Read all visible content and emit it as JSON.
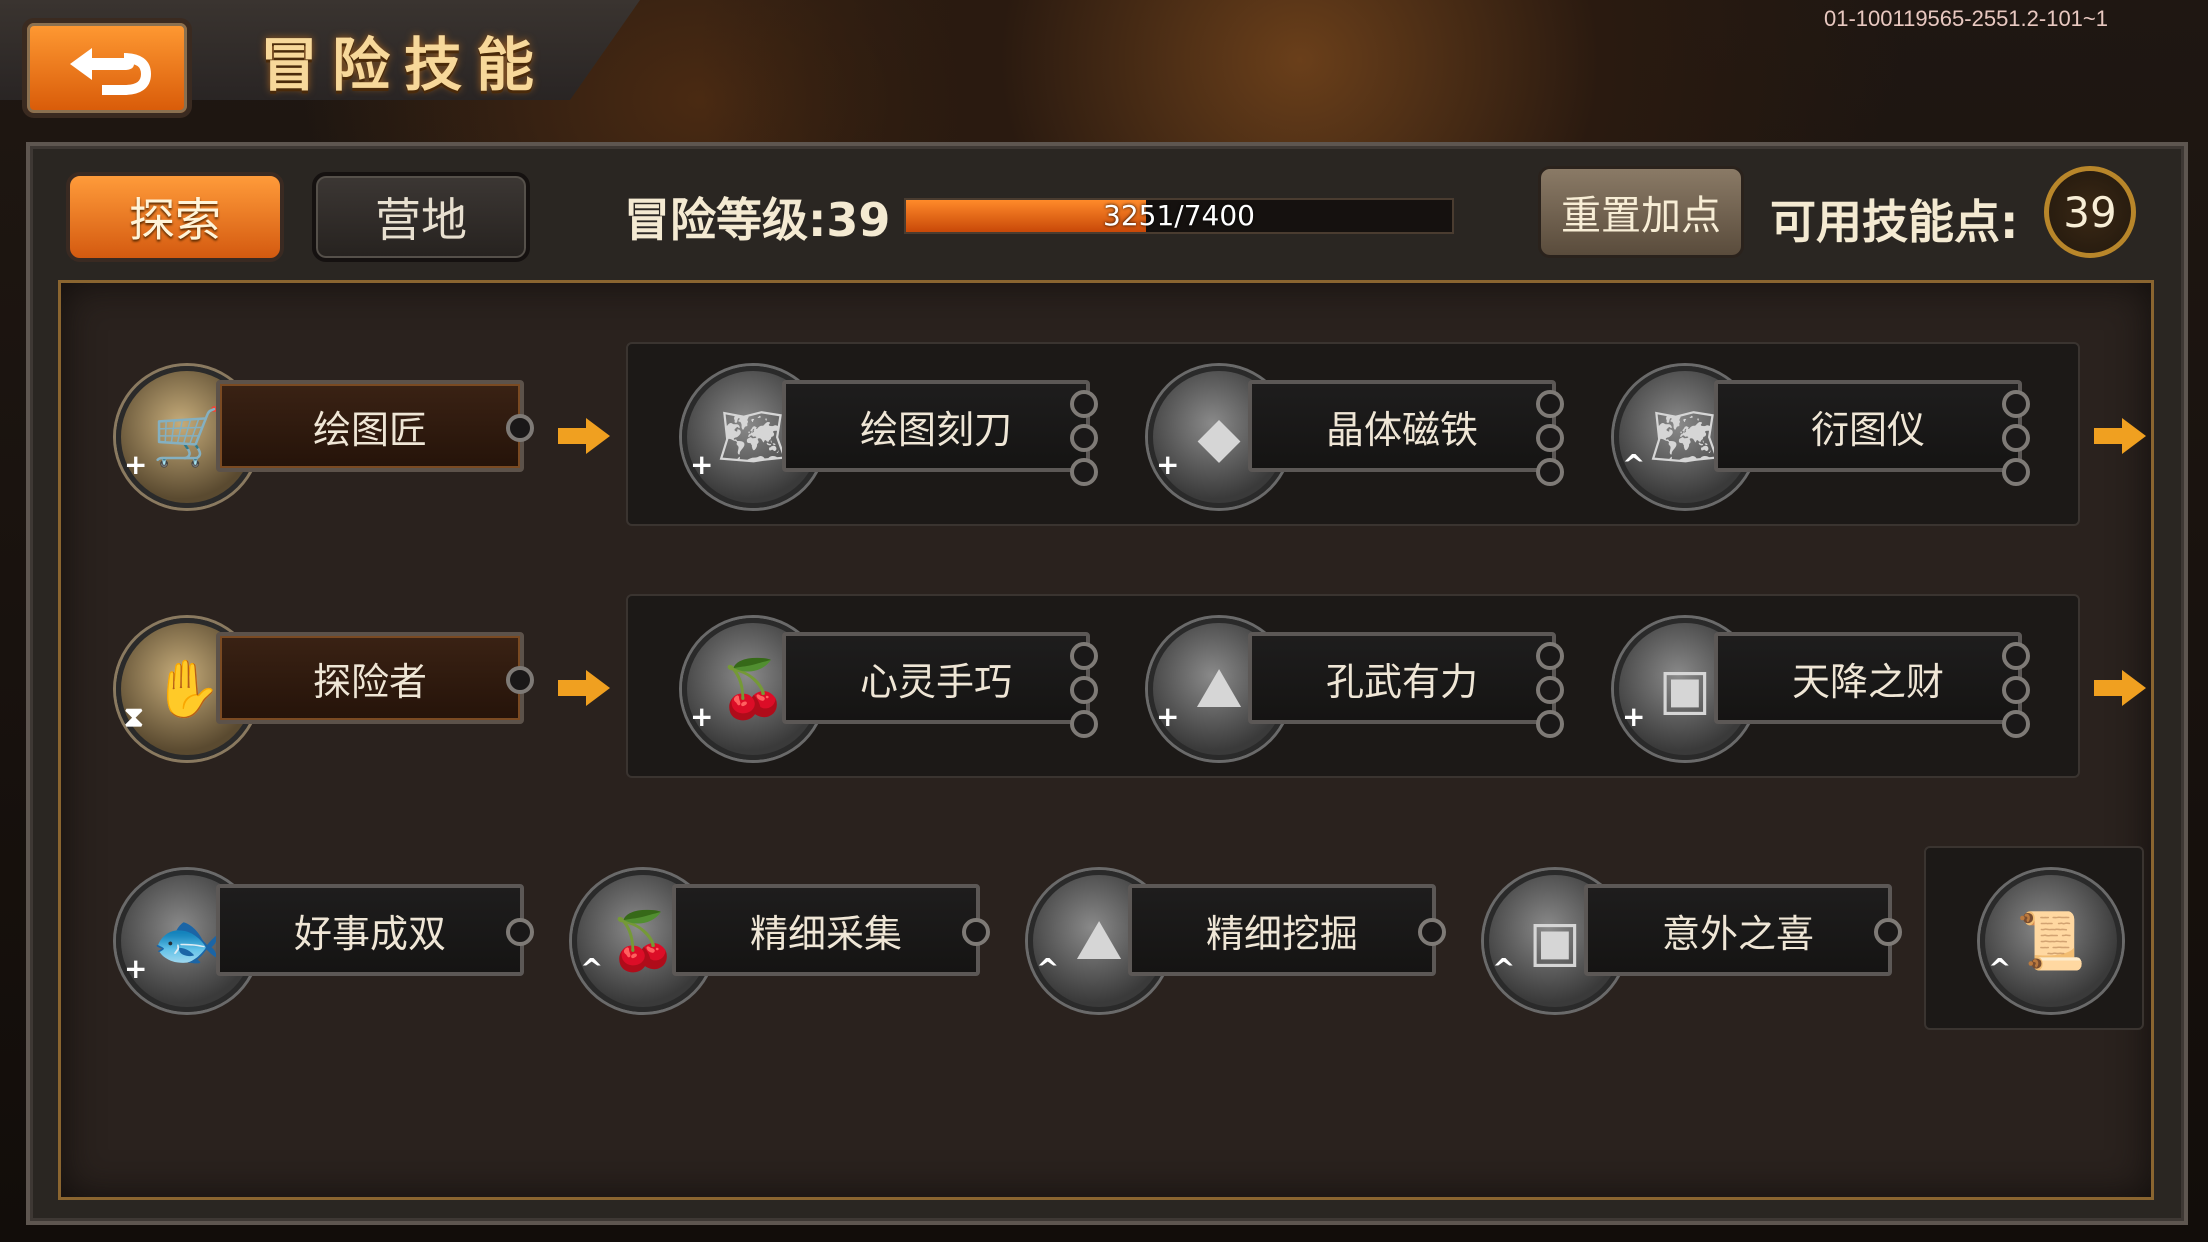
{
  "build_id": "01-100119565-2551.2-101~1",
  "header": {
    "title": "冒险技能"
  },
  "tabs": [
    {
      "label": "探索",
      "active": true
    },
    {
      "label": "营地",
      "active": false
    }
  ],
  "level": {
    "label": "冒险等级:39",
    "xp_text": "3251/7400",
    "xp_current": 3251,
    "xp_max": 7400
  },
  "reset_label": "重置加点",
  "points": {
    "label": "可用技能点:",
    "value": "39"
  },
  "rows": [
    {
      "base": {
        "name": "绘图匠",
        "icon": "cart-icon",
        "badge": "+"
      },
      "skills": [
        {
          "name": "绘图刻刀",
          "icon": "map-pin-icon",
          "badge": "+"
        },
        {
          "name": "晶体磁铁",
          "icon": "crystal-icon",
          "badge": "+"
        },
        {
          "name": "衍图仪",
          "icon": "map-icon",
          "badge": "^"
        }
      ]
    },
    {
      "base": {
        "name": "探险者",
        "icon": "glove-icon",
        "badge": "⧗"
      },
      "skills": [
        {
          "name": "心灵手巧",
          "icon": "fruit-icon",
          "badge": "+"
        },
        {
          "name": "孔武有力",
          "icon": "rock-icon",
          "badge": "+"
        },
        {
          "name": "天降之财",
          "icon": "chest-icon",
          "badge": "+"
        }
      ]
    }
  ],
  "bottom_row": [
    {
      "name": "好事成双",
      "icon": "fish-icon",
      "badge": "+"
    },
    {
      "name": "精细采集",
      "icon": "fruit-icon",
      "badge": "^"
    },
    {
      "name": "精细挖掘",
      "icon": "rock-icon",
      "badge": "^"
    },
    {
      "name": "意外之喜",
      "icon": "chest-icon",
      "badge": "^"
    },
    {
      "name": "",
      "icon": "scroll-map-icon",
      "badge": "^"
    }
  ]
}
